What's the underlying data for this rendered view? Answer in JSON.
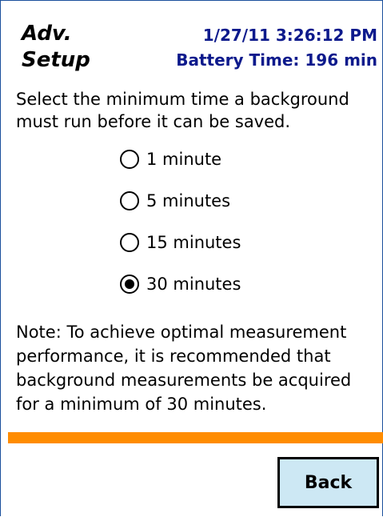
{
  "header": {
    "title_line1": "Adv.",
    "title_line2": "Setup",
    "datetime": "1/27/11 3:26:12 PM",
    "battery": "Battery Time: 196 min"
  },
  "instruction": "Select the minimum time a background must run before it can be saved.",
  "options": [
    {
      "label": "1 minute",
      "selected": false
    },
    {
      "label": "5 minutes",
      "selected": false
    },
    {
      "label": "15 minutes",
      "selected": false
    },
    {
      "label": "30 minutes",
      "selected": true
    }
  ],
  "note": "Note: To achieve optimal measurement performance, it is recommended that background measurements be acquired for a minimum of 30 minutes.",
  "colors": {
    "header_text": "#0d1a8c",
    "divider": "#ff8c00",
    "button_bg": "#cde8f4"
  },
  "footer": {
    "back_label": "Back"
  }
}
